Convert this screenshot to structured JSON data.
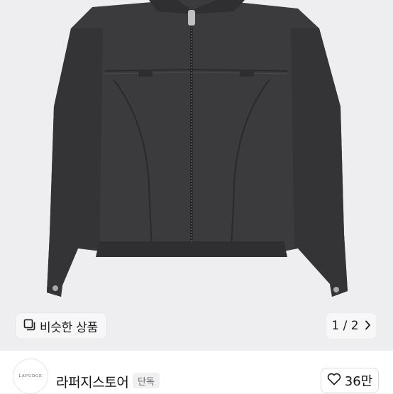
{
  "product": {
    "image_alt": "black denim zip-up jacket"
  },
  "similar_button": {
    "label": "비슷한 상품",
    "icon": "similar-items-icon"
  },
  "pager": {
    "current": "1 / 2",
    "icon": "chevron-right-icon"
  },
  "seller": {
    "logo_text": "LAFUDGE",
    "name": "라퍼지스토어",
    "badge": "단독"
  },
  "like": {
    "count": "36만",
    "icon": "heart-icon"
  },
  "colors": {
    "background": "#eeeef0",
    "jacket": "#3a3a3c",
    "text": "#1c1c1e"
  }
}
